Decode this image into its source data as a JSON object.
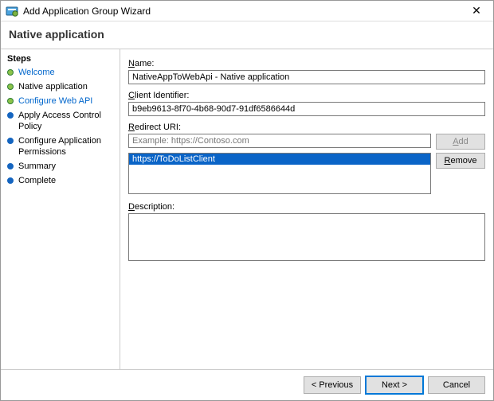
{
  "window": {
    "title": "Add Application Group Wizard",
    "close_glyph": "✕"
  },
  "page_heading": "Native application",
  "sidebar": {
    "heading": "Steps",
    "items": [
      {
        "label": "Welcome",
        "state": "done",
        "link": true
      },
      {
        "label": "Native application",
        "state": "done",
        "link": false
      },
      {
        "label": "Configure Web API",
        "state": "done",
        "link": true
      },
      {
        "label": "Apply Access Control Policy",
        "state": "pending",
        "link": false
      },
      {
        "label": "Configure Application Permissions",
        "state": "pending",
        "link": false
      },
      {
        "label": "Summary",
        "state": "pending",
        "link": false
      },
      {
        "label": "Complete",
        "state": "pending",
        "link": false
      }
    ]
  },
  "form": {
    "name_label": "Name:",
    "name_value": "NativeAppToWebApi - Native application",
    "client_id_label": "Client Identifier:",
    "client_id_value": "b9eb9613-8f70-4b68-90d7-91df6586644d",
    "redirect_label": "Redirect URI:",
    "redirect_placeholder": "Example: https://Contoso.com",
    "redirect_value": "",
    "redirect_list": [
      {
        "value": "https://ToDoListClient",
        "selected": true
      }
    ],
    "add_label": "Add",
    "remove_label": "Remove",
    "description_label": "Description:",
    "description_value": ""
  },
  "footer": {
    "previous": "< Previous",
    "next": "Next >",
    "cancel": "Cancel"
  }
}
